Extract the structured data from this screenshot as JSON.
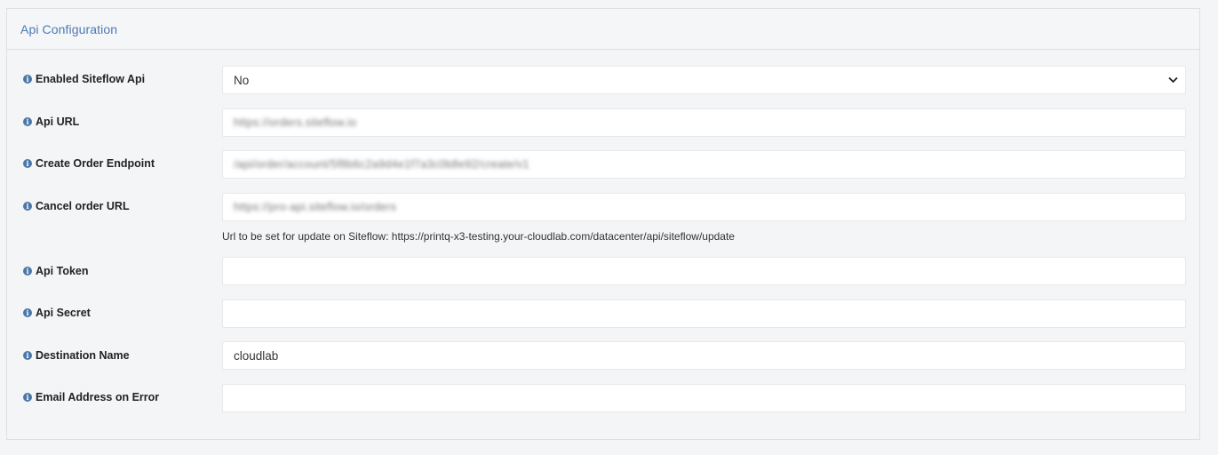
{
  "panel": {
    "title": "Api Configuration"
  },
  "fields": [
    {
      "label": "Enabled Siteflow Api",
      "type": "select",
      "value": "No"
    },
    {
      "label": "Api URL",
      "type": "text",
      "value": "https://orders.siteflow.io"
    },
    {
      "label": "Create Order Endpoint",
      "type": "text",
      "value": "/api/order/account/5f8b6c2a9d4e1f7a3c0b8e92/create/v1"
    },
    {
      "label": "Cancel order URL",
      "type": "text",
      "value": "https://pro-api.siteflow.io/orders"
    },
    {
      "label": "Api Token",
      "type": "text",
      "value": ""
    },
    {
      "label": "Api Secret",
      "type": "text",
      "value": ""
    },
    {
      "label": "Destination Name",
      "type": "text",
      "value": "cloudlab"
    },
    {
      "label": "Email Address on Error",
      "type": "text",
      "value": ""
    }
  ],
  "hint": {
    "text": "Url to be set for update on Siteflow: https://printq-x3-testing.your-cloudlab.com/datacenter/api/siteflow/update"
  },
  "icons": {
    "info": "info-circle-icon",
    "chevron": "chevron-down-icon"
  },
  "colors": {
    "title": "#4a7ab4",
    "info_icon": "#4a77a8",
    "panel_border": "#dcdfe3"
  }
}
